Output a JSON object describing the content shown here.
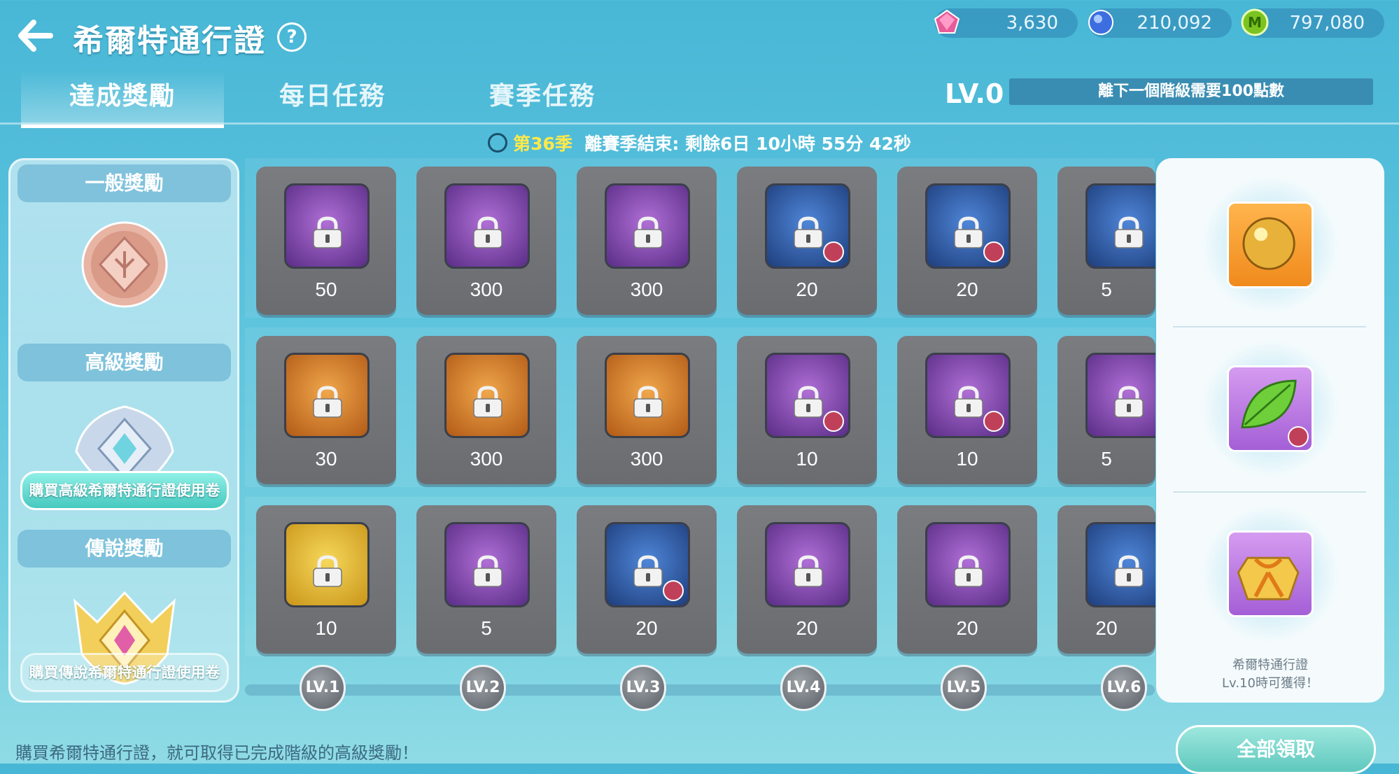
{
  "header": {
    "title": "希爾特通行證",
    "help": "?",
    "currencies": [
      {
        "icon": "pink-gem-icon",
        "value": "3,630"
      },
      {
        "icon": "blue-gem-icon",
        "value": "210,092"
      },
      {
        "icon": "green-coin-icon",
        "value": "797,080"
      }
    ]
  },
  "tabs": [
    "達成獎勵",
    "每日任務",
    "賽季任務"
  ],
  "level": {
    "label": "LV.0",
    "progress_text": "離下一個階級需要100點數"
  },
  "season": {
    "number_label": "第36季",
    "remaining_text": "離賽季結束: 剩餘6日 10小時 55分 42秒"
  },
  "tiers": {
    "normal": "一般獎勵",
    "advanced": "高級獎勵",
    "buy_advanced": "購買高級希爾特通行證使用卷",
    "legend": "傳說獎勵",
    "buy_legend": "購買傳說希爾特通行證使用卷"
  },
  "grid": {
    "rows": [
      [
        {
          "item": "love-jar-icon",
          "bg": "purple",
          "qty": "50",
          "no_badge": false
        },
        {
          "item": "blue-potion-icon",
          "bg": "purple",
          "qty": "300",
          "no_badge": false
        },
        {
          "item": "red-potion-icon",
          "bg": "purple",
          "qty": "300",
          "no_badge": false
        },
        {
          "item": "cupcake-icon",
          "bg": "blue",
          "qty": "20",
          "no_badge": true
        },
        {
          "item": "strawberry-sandwich-icon",
          "bg": "blue",
          "qty": "20",
          "no_badge": true
        },
        {
          "item": "onion-rings-icon",
          "bg": "blue",
          "qty": "5",
          "no_badge": false
        }
      ],
      [
        {
          "item": "winged-jar-icon",
          "bg": "orange",
          "qty": "30",
          "no_badge": false
        },
        {
          "item": "red-potion-icon",
          "bg": "orange",
          "qty": "300",
          "no_badge": false
        },
        {
          "item": "blue-potion-icon",
          "bg": "orange",
          "qty": "300",
          "no_badge": false
        },
        {
          "item": "burger-icon",
          "bg": "purple",
          "qty": "10",
          "no_badge": true
        },
        {
          "item": "sandwich-icon",
          "bg": "purple",
          "qty": "10",
          "no_badge": true
        },
        {
          "item": "pizza-icon",
          "bg": "purple",
          "qty": "5",
          "no_badge": false
        }
      ],
      [
        {
          "item": "green-jar-icon",
          "bg": "yellow",
          "qty": "10",
          "no_badge": false
        },
        {
          "item": "fries-icon",
          "bg": "purple",
          "qty": "5",
          "no_badge": false
        },
        {
          "item": "pink-crystal-icon",
          "bg": "blue",
          "qty": "20",
          "no_badge": true
        },
        {
          "item": "soup-bowl-icon",
          "bg": "purple",
          "qty": "20",
          "no_badge": false
        },
        {
          "item": "tea-cup-icon",
          "bg": "purple",
          "qty": "20",
          "no_badge": false
        },
        {
          "item": "onion-rings-icon",
          "bg": "blue",
          "qty": "20",
          "no_badge": false
        }
      ]
    ]
  },
  "level_nodes": [
    "LV.1",
    "LV.2",
    "LV.3",
    "LV.4",
    "LV.5",
    "LV.6"
  ],
  "side_preview": {
    "items": [
      "gold-orb-icon",
      "green-leaf-icon",
      "gold-gift-box-icon"
    ],
    "caption_line1": "希爾特通行證",
    "caption_line2": "Lv.10時可獲得！"
  },
  "footer": {
    "note": "購買希爾特通行證，就可取得已完成階級的高級獎勵！",
    "claim_all": "全部領取"
  },
  "colors": {
    "season_number": "#ffe94a",
    "locked_cell": "#6f7175",
    "buy_button": "#5fcfc5"
  }
}
